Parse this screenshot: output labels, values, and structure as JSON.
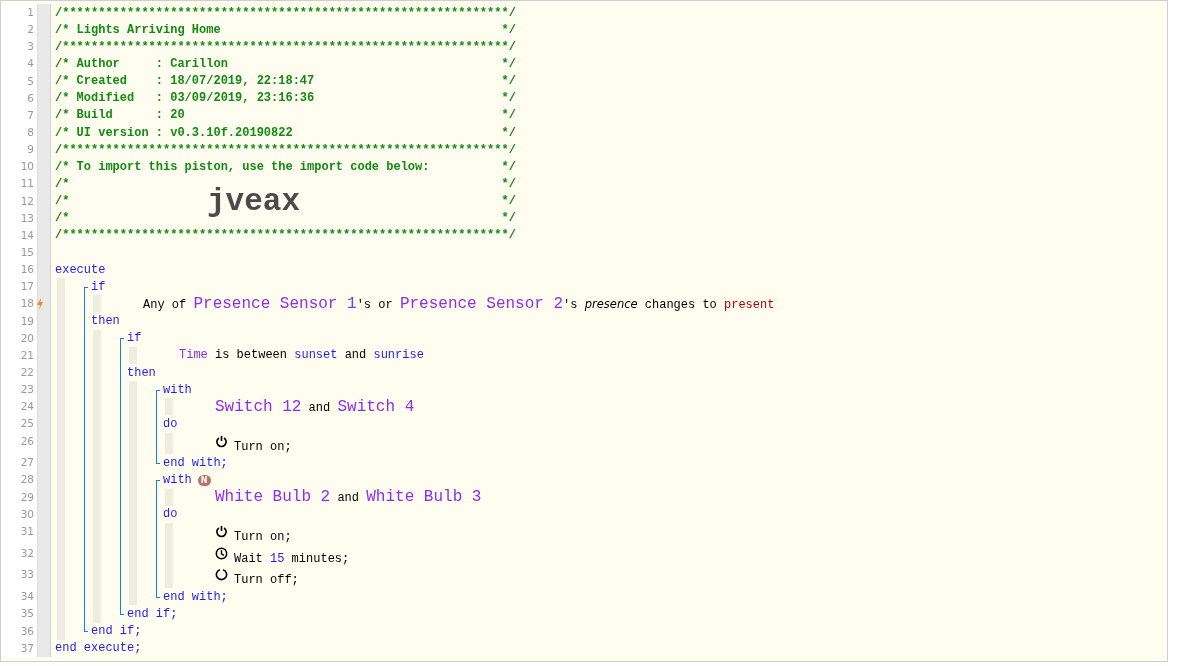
{
  "line_numbers": [
    "1",
    "2",
    "3",
    "4",
    "5",
    "6",
    "7",
    "8",
    "9",
    "10",
    "11",
    "12",
    "13",
    "14",
    "15",
    "16",
    "17",
    "18",
    "19",
    "20",
    "21",
    "22",
    "23",
    "24",
    "25",
    "26",
    "27",
    "28",
    "29",
    "30",
    "31",
    "32",
    "33",
    "34",
    "35",
    "36",
    "37"
  ],
  "header": [
    {
      "kind": "rule",
      "text": "/**************************************************************/"
    },
    {
      "kind": "comment",
      "text": "/* Lights Arriving Home",
      "close": "*/"
    },
    {
      "kind": "rule",
      "text": "/**************************************************************/"
    },
    {
      "kind": "comment",
      "text": "/* Author     : Carillon",
      "close": "*/"
    },
    {
      "kind": "comment",
      "text": "/* Created    : 18/07/2019, 22:18:47",
      "close": "*/"
    },
    {
      "kind": "comment",
      "text": "/* Modified   : 03/09/2019, 23:16:36",
      "close": "*/"
    },
    {
      "kind": "comment",
      "text": "/* Build      : 20",
      "close": "*/"
    },
    {
      "kind": "comment",
      "text": "/* UI version : v0.3.10f.20190822",
      "close": "*/"
    },
    {
      "kind": "rule",
      "text": "/**************************************************************/"
    },
    {
      "kind": "comment",
      "text": "/* To import this piston, use the import code below:",
      "close": "*/"
    },
    {
      "kind": "comment",
      "text": "/*",
      "close": "*/"
    },
    {
      "kind": "comment",
      "text": "/*",
      "close": "*/",
      "import_code": "jveax"
    },
    {
      "kind": "comment",
      "text": "/*",
      "close": "*/"
    },
    {
      "kind": "rule",
      "text": "/**************************************************************/"
    }
  ],
  "program": {
    "keyword": "execute",
    "end": "end execute;",
    "body": [
      {
        "kind": "if",
        "then": "then",
        "end": "end if;",
        "conditions": [
          {
            "trigger": true,
            "tokens": [
              {
                "kind": "plain",
                "text": "Any of "
              },
              {
                "kind": "device",
                "text": "Presence Sensor 1"
              },
              {
                "kind": "plain",
                "text": "'s or "
              },
              {
                "kind": "device",
                "text": "Presence Sensor 2"
              },
              {
                "kind": "plain",
                "text": "'s "
              },
              {
                "kind": "italic",
                "text": "presence"
              },
              {
                "kind": "plain",
                "text": " changes to "
              },
              {
                "kind": "state",
                "text": "present"
              }
            ]
          }
        ],
        "body": [
          {
            "kind": "if",
            "then": "then",
            "end": "end if;",
            "conditions": [
              {
                "trigger": false,
                "tokens": [
                  {
                    "kind": "variable",
                    "text": "Time"
                  },
                  {
                    "kind": "plain",
                    "text": " is between "
                  },
                  {
                    "kind": "constant",
                    "text": "sunset"
                  },
                  {
                    "kind": "plain",
                    "text": " and "
                  },
                  {
                    "kind": "constant",
                    "text": "sunrise"
                  }
                ]
              }
            ],
            "body": [
              {
                "kind": "with",
                "do": "do",
                "end": "end with;",
                "devices": [
                  {
                    "kind": "device",
                    "text": "Switch 12"
                  },
                  {
                    "kind": "plain",
                    "text": " and "
                  },
                  {
                    "kind": "device",
                    "text": "Switch 4"
                  }
                ],
                "actions": [
                  {
                    "kind": "on",
                    "tokens": [
                      {
                        "kind": "plain",
                        "text": "Turn on;"
                      }
                    ]
                  }
                ]
              },
              {
                "kind": "with",
                "badge": "N",
                "do": "do",
                "end": "end with;",
                "devices": [
                  {
                    "kind": "device",
                    "text": "White Bulb 2"
                  },
                  {
                    "kind": "plain",
                    "text": " and "
                  },
                  {
                    "kind": "device",
                    "text": "White Bulb 3"
                  }
                ],
                "actions": [
                  {
                    "kind": "on",
                    "tokens": [
                      {
                        "kind": "plain",
                        "text": "Turn on;"
                      }
                    ]
                  },
                  {
                    "kind": "wait",
                    "tokens": [
                      {
                        "kind": "plain",
                        "text": "Wait "
                      },
                      {
                        "kind": "constant",
                        "text": "15"
                      },
                      {
                        "kind": "plain",
                        "text": " minutes;"
                      }
                    ]
                  },
                  {
                    "kind": "off",
                    "tokens": [
                      {
                        "kind": "plain",
                        "text": "Turn off;"
                      }
                    ]
                  }
                ]
              }
            ]
          }
        ]
      }
    ]
  }
}
